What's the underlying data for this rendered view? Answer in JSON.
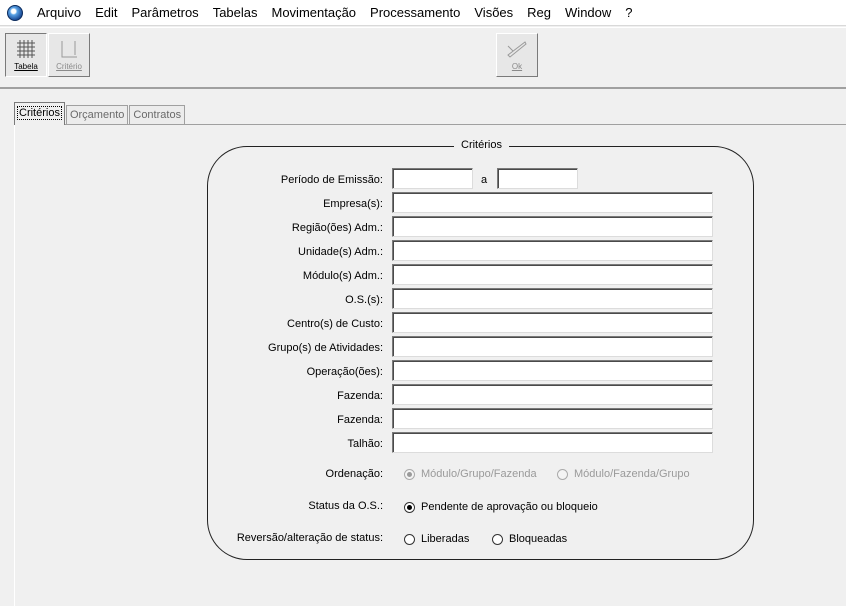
{
  "menu": [
    "Arquivo",
    "Edit",
    "Parâmetros",
    "Tabelas",
    "Movimentação",
    "Processamento",
    "Visões",
    "Reg",
    "Window",
    "?"
  ],
  "toolbar": {
    "tabela_label": "Tabela",
    "criterio_label": "Critério",
    "ok_label": "Ok"
  },
  "tabs": [
    {
      "label": "Critérios",
      "active": true
    },
    {
      "label": "Orçamento",
      "active": false
    },
    {
      "label": "Contratos",
      "active": false
    }
  ],
  "group": {
    "title": "Critérios",
    "periodo_label": "Período de Emissão:",
    "periodo_sep": "a",
    "periodo_from": "",
    "periodo_to": "",
    "fields": [
      {
        "label": "Empresa(s):",
        "value": ""
      },
      {
        "label": "Região(ões) Adm.:",
        "value": ""
      },
      {
        "label": "Unidade(s) Adm.:",
        "value": ""
      },
      {
        "label": "Módulo(s) Adm.:",
        "value": ""
      },
      {
        "label": "O.S.(s):",
        "value": ""
      },
      {
        "label": "Centro(s) de Custo:",
        "value": ""
      },
      {
        "label": "Grupo(s) de Atividades:",
        "value": ""
      },
      {
        "label": "Operação(ões):",
        "value": ""
      },
      {
        "label": "Fazenda:",
        "value": ""
      },
      {
        "label": "Fazenda:",
        "value": ""
      },
      {
        "label": "Talhão:",
        "value": ""
      }
    ],
    "ordenacao": {
      "label": "Ordenação:",
      "options": [
        {
          "label": "Módulo/Grupo/Fazenda",
          "selected": true
        },
        {
          "label": "Módulo/Fazenda/Grupo",
          "selected": false
        }
      ]
    },
    "status": {
      "label": "Status da O.S.:",
      "options": [
        {
          "label": "Pendente de aprovação ou bloqueio",
          "selected": true
        }
      ]
    },
    "reversao": {
      "label": "Reversão/alteração de status:",
      "options": [
        {
          "label": "Liberadas",
          "selected": false
        },
        {
          "label": "Bloqueadas",
          "selected": false
        }
      ]
    }
  }
}
